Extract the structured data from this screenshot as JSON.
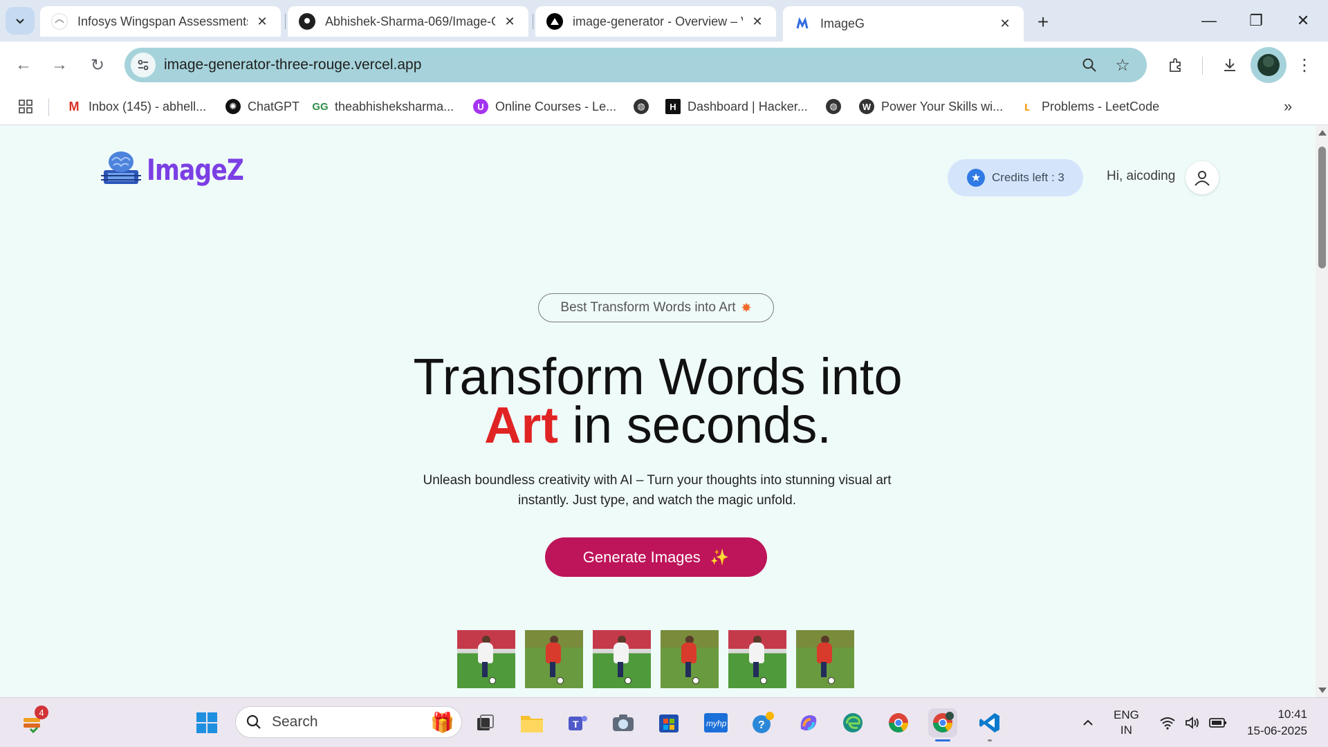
{
  "browser": {
    "tabs": [
      {
        "title": "Infosys Wingspan Assessments",
        "favicon": "wingspan-icon",
        "active": false
      },
      {
        "title": "Abhishek-Sharma-069/Image-G",
        "favicon": "github-icon",
        "active": false
      },
      {
        "title": "image-generator - Overview – V",
        "favicon": "vercel-icon",
        "active": false
      },
      {
        "title": "ImageG",
        "favicon": "imageg-icon",
        "active": true
      }
    ],
    "url": "image-generator-three-rouge.vercel.app",
    "bookmarks": [
      {
        "label": "Inbox (145) - abhell...",
        "icon": "gmail-icon"
      },
      {
        "label": "ChatGPT",
        "icon": "chatgpt-icon"
      },
      {
        "label": "theabhisheksharma...",
        "icon": "gfg-icon"
      },
      {
        "label": "Online Courses - Le...",
        "icon": "udemy-icon"
      },
      {
        "label": "",
        "icon": "globe-icon"
      },
      {
        "label": "Dashboard | Hacker...",
        "icon": "hackerrank-icon"
      },
      {
        "label": "",
        "icon": "globe-icon"
      },
      {
        "label": "Power Your Skills wi...",
        "icon": "wordpress-icon"
      },
      {
        "label": "Problems - LeetCode",
        "icon": "leetcode-icon"
      }
    ]
  },
  "page": {
    "logo_text": "ImageZ",
    "credits_label": "Credits left : 3",
    "greeting": "Hi, aicoding",
    "badge_text": "Best Transform Words into Art",
    "badge_icon": "sparkle-icon",
    "headline_line1": "Transform Words into",
    "headline_accent": "Art",
    "headline_line2_rest": " in seconds.",
    "subtitle": "Unleash boundless creativity with AI – Turn your thoughts into stunning visual art instantly. Just type, and watch the magic unfold.",
    "cta_label": "Generate Images",
    "cta_icon": "sparkles-icon",
    "sample_images": [
      "soccer-player-image",
      "soccer-player-image",
      "soccer-player-image",
      "soccer-player-image",
      "soccer-player-image",
      "soccer-player-image"
    ],
    "accent_color": "#e02424",
    "cta_color": "#be1459",
    "logo_color": "#7b3fe4",
    "page_background": "#effbf9"
  },
  "taskbar": {
    "widget_badge": "4",
    "search_placeholder": "Search",
    "language": "ENG",
    "region": "IN",
    "time": "10:41",
    "date": "15-06-2025"
  }
}
